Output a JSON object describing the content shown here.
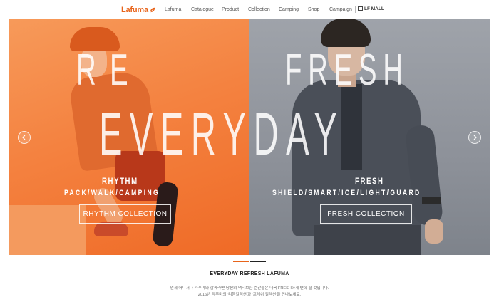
{
  "nav": {
    "logo": "Lafuma",
    "items": [
      "Lafuma",
      "Catalogue",
      "Product",
      "Collection",
      "Camping",
      "Shop",
      "Campaign"
    ],
    "mall_label": "LF MALL"
  },
  "hero": {
    "left": {
      "headline": "RE",
      "subtitle": "RHYTHM",
      "tags": "PACK/WALK/CAMPING",
      "button": "RHYTHM COLLECTION",
      "color": "#f48240"
    },
    "right": {
      "headline": "FRESH",
      "subtitle": "FRESH",
      "tags": "SHIELD/SMART/ICE/LIGHT/GUARD",
      "button": "FRESH COLLECTION",
      "color": "#8d9199"
    },
    "center_headline": "EVERYDAY",
    "prev_icon": "chevron-left-icon",
    "next_icon": "chevron-right-icon"
  },
  "slider": {
    "active_index": 1,
    "count": 2,
    "active_color": "#e8641b"
  },
  "footer": {
    "headline": "EVERYDAY REFRESH LAFUMA",
    "desc_line1": "언제 어디서나 라푸마와 함께라면 당신의 액티브한 순간들은 더욱 FRESH하게 변화 할 것입니다.",
    "desc_line2": "2016년 라푸마의 '리듬컬렉션'과 '프레쉬 컬렉션'을 만나보세요."
  }
}
